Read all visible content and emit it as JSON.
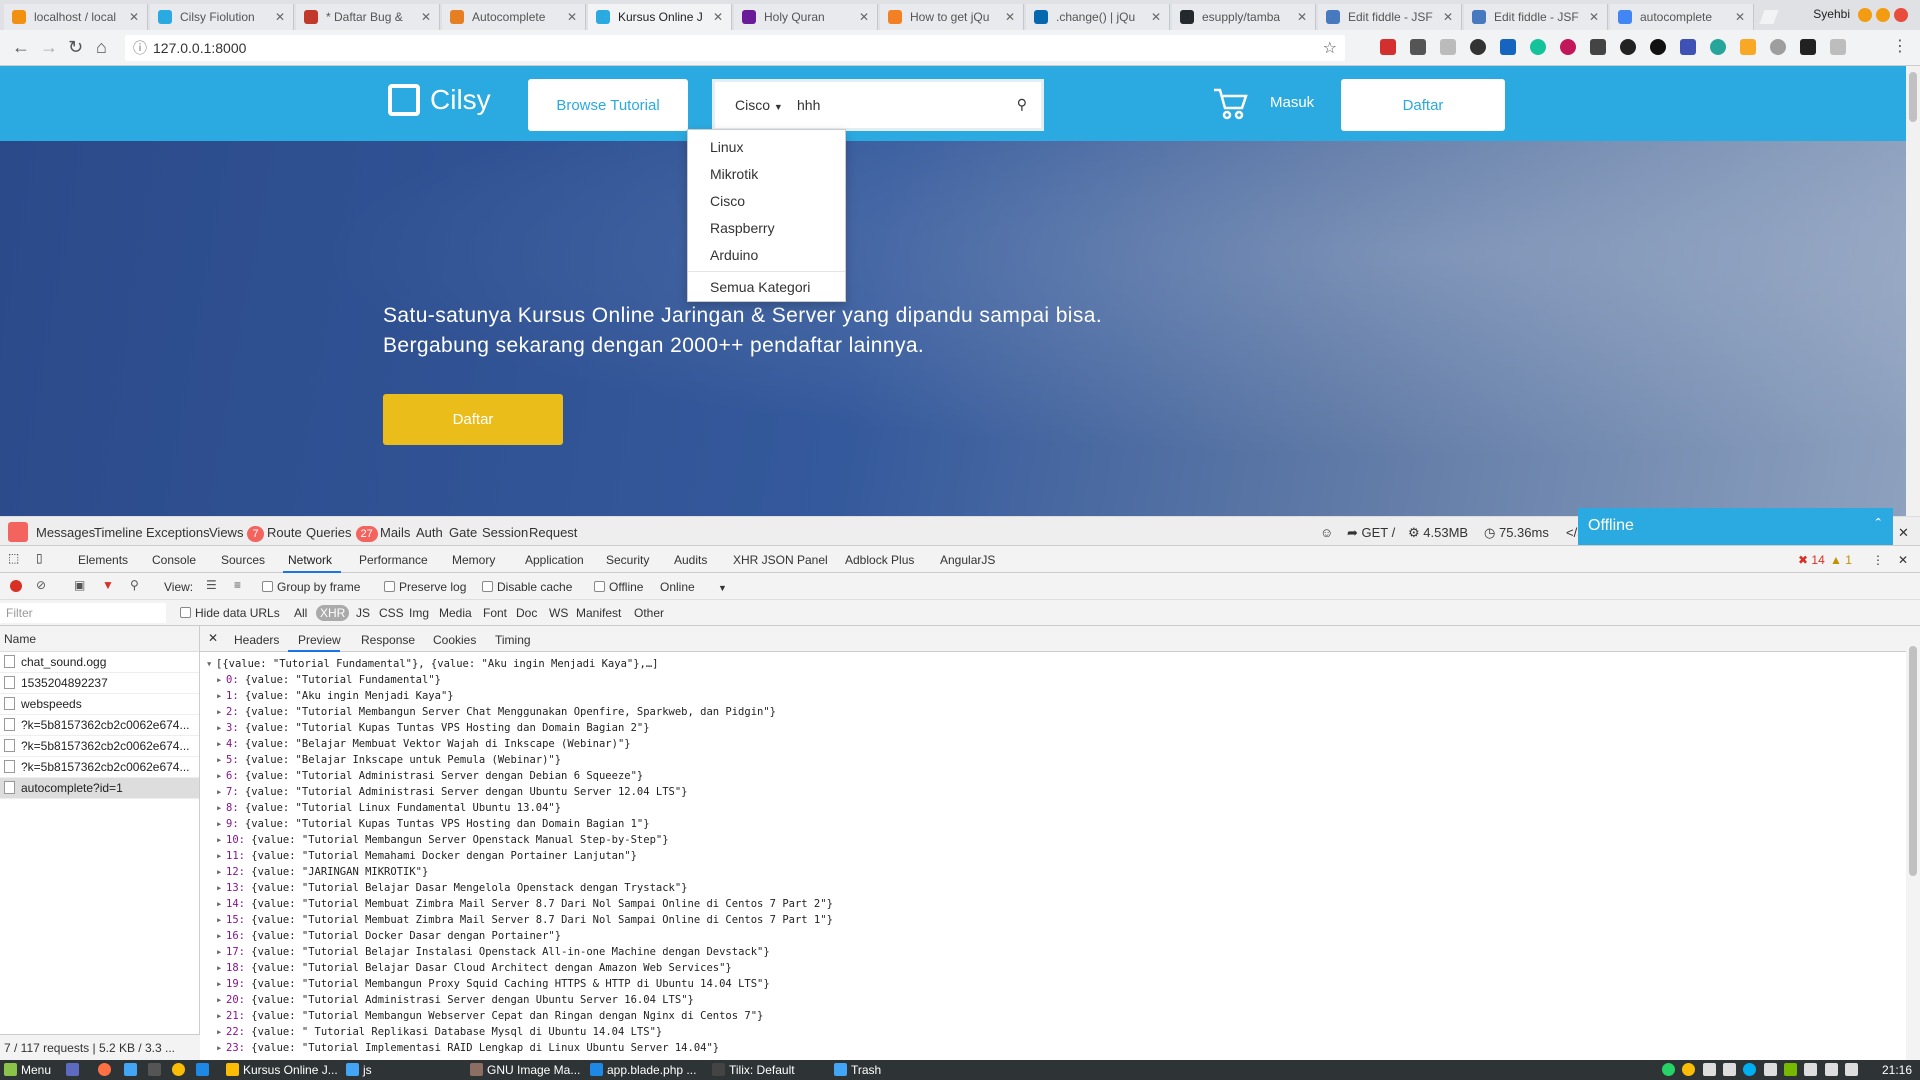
{
  "browser": {
    "tabs": [
      {
        "title": "localhost / local",
        "color": "#f29111"
      },
      {
        "title": "Cilsy Fiolution",
        "color": "#2baae1"
      },
      {
        "title": "* Daftar Bug &",
        "color": "#c0392b"
      },
      {
        "title": "Autocomplete",
        "color": "#e67e22"
      },
      {
        "title": "Kursus Online J",
        "color": "#2baae1"
      },
      {
        "title": "Holy Quran",
        "color": "#6a1b9a"
      },
      {
        "title": "How to get jQu",
        "color": "#f48024"
      },
      {
        "title": ".change() | jQu",
        "color": "#0769ad"
      },
      {
        "title": "esupply/tamba",
        "color": "#24292e"
      },
      {
        "title": "Edit fiddle - JSF",
        "color": "#4679bd"
      },
      {
        "title": "Edit fiddle - JSF",
        "color": "#4679bd"
      },
      {
        "title": "autocomplete",
        "color": "#4285f4"
      }
    ],
    "active_tab_index": 4,
    "user": "Syehbi",
    "url": "127.0.0.1:8000"
  },
  "site": {
    "logo": "Cilsy",
    "browse_button": "Browse Tutorial",
    "search": {
      "category": "Cisco",
      "value": "hhh"
    },
    "categories": [
      "Linux",
      "Mikrotik",
      "Cisco",
      "Raspberry",
      "Arduino"
    ],
    "all_categories": "Semua Kategori",
    "login": "Masuk",
    "register": "Daftar",
    "hero_line1": "Satu-satunya Kursus Online Jaringan & Server yang dipandu sampai bisa.",
    "hero_line2": "Bergabung sekarang dengan 2000++ pendaftar lainnya.",
    "hero_button": "Daftar",
    "colors": {
      "primary": "#2baae1",
      "accent": "#ebbd1a"
    }
  },
  "debugbar": {
    "tabs": [
      "Messages",
      "Timeline",
      "Exceptions",
      "Views",
      "Route",
      "Queries",
      "Mails",
      "Auth",
      "Gate",
      "Session",
      "Request"
    ],
    "views_count": "7",
    "queries_count": "27",
    "method": "GET /",
    "memory": "4.53MB",
    "time": "75.36ms"
  },
  "chat": {
    "status": "Offline"
  },
  "devtools": {
    "tabs": [
      "Elements",
      "Console",
      "Sources",
      "Network",
      "Performance",
      "Memory",
      "Application",
      "Security",
      "Audits",
      "XHR JSON Panel",
      "Adblock Plus",
      "AngularJS"
    ],
    "errors": "14",
    "warnings": "1",
    "toolbar": {
      "view_label": "View:",
      "group_by_frame": "Group by frame",
      "preserve_log": "Preserve log",
      "disable_cache": "Disable cache",
      "offline": "Offline",
      "throttle": "Online"
    },
    "filter": {
      "placeholder": "Filter",
      "hide_data_urls": "Hide data URLs",
      "types": [
        "All",
        "XHR",
        "JS",
        "CSS",
        "Img",
        "Media",
        "Font",
        "Doc",
        "WS",
        "Manifest",
        "Other"
      ],
      "selected_type": "XHR"
    },
    "name_header": "Name",
    "requests": [
      "chat_sound.ogg",
      "1535204892237",
      "webspeeds",
      "?k=5b8157362cb2c0062e674...",
      "?k=5b8157362cb2c0062e674...",
      "?k=5b8157362cb2c0062e674...",
      "autocomplete?id=1"
    ],
    "selected_request": 6,
    "status": "7 / 117 requests  |  5.2 KB / 3.3 ...",
    "detail_tabs": [
      "Headers",
      "Preview",
      "Response",
      "Cookies",
      "Timing"
    ],
    "preview_summary": "[{value: \"Tutorial Fundamental\"}, {value: \"Aku ingin Menjadi Kaya\"},…]",
    "preview_items": [
      "Tutorial Fundamental",
      "Aku ingin Menjadi Kaya",
      "Tutorial Membangun Server Chat Menggunakan Openfire, Sparkweb, dan Pidgin",
      "Tutorial Kupas Tuntas VPS Hosting dan Domain Bagian 2",
      "Belajar Membuat Vektor Wajah di Inkscape (Webinar)",
      "Belajar Inkscape untuk Pemula (Webinar)",
      "Tutorial Administrasi Server dengan Debian 6 Squeeze",
      "Tutorial Administrasi Server dengan Ubuntu Server 12.04 LTS",
      "Tutorial Linux Fundamental Ubuntu 13.04",
      "Tutorial Kupas Tuntas VPS Hosting dan Domain Bagian 1",
      "Tutorial Membangun Server Openstack Manual Step-by-Step",
      "Tutorial Memahami Docker dengan Portainer Lanjutan",
      "JARINGAN MIKROTIK",
      "Tutorial Belajar Dasar Mengelola Openstack dengan Trystack",
      "Tutorial Membuat Zimbra Mail Server 8.7 Dari Nol Sampai Online di Centos 7 Part 2",
      "Tutorial Membuat Zimbra Mail Server 8.7 Dari Nol Sampai Online di Centos 7 Part 1",
      "Tutorial Docker Dasar dengan Portainer",
      "Tutorial Belajar Instalasi Openstack All-in-one Machine dengan Devstack",
      "Tutorial Belajar Dasar Cloud Architect dengan Amazon Web Services",
      "Tutorial Membangun Proxy Squid Caching HTTPS & HTTP di Ubuntu 14.04 LTS",
      "Tutorial Administrasi Server dengan Ubuntu Server 16.04 LTS",
      "Tutorial Membangun Webserver Cepat dan Ringan dengan Nginx di Centos 7",
      " Tutorial Replikasi Database Mysql di Ubuntu 14.04 LTS",
      "Tutorial Implementasi RAID Lengkap di Linux Ubuntu Server 14.04"
    ]
  },
  "taskbar": {
    "menu": "Menu",
    "items": [
      "Kursus Online J...",
      "js",
      "GNU Image Ma...",
      "app.blade.php ...",
      "Tilix: Default",
      "Trash"
    ],
    "clock": "21:16"
  }
}
